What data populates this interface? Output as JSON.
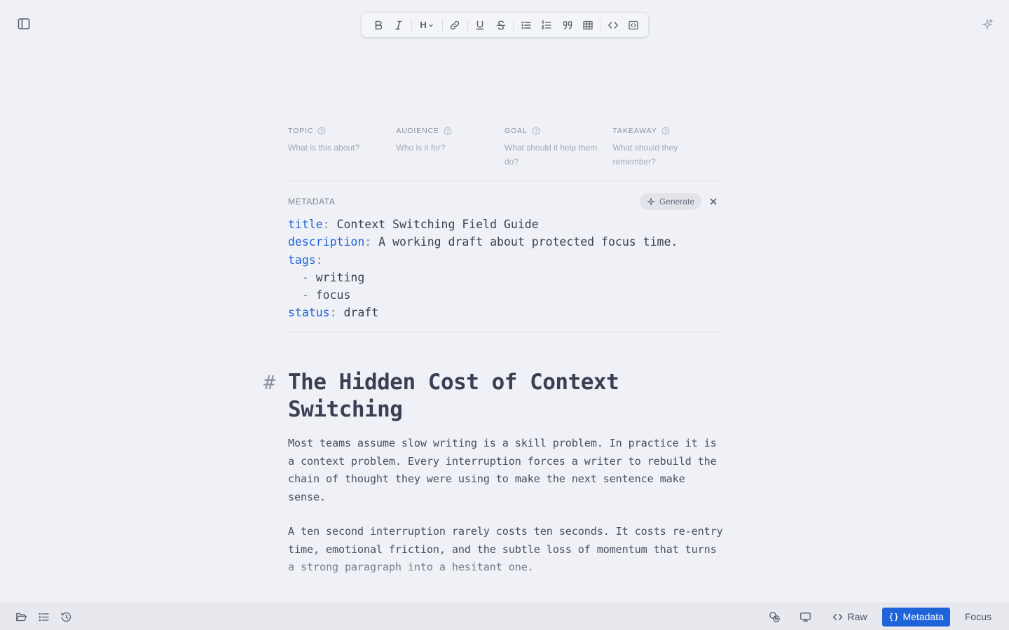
{
  "colors": {
    "accent": "#1f63d8",
    "background": "#eff1f6",
    "text": "#3d4052",
    "muted": "#8b8fa0"
  },
  "header": {
    "sidebar_toggle_icon": "sidebar-panel-icon",
    "assistant_icon": "sparkle-icon"
  },
  "toolbar": {
    "heading_label": "H",
    "icons": [
      "bold-icon",
      "italic-icon",
      "heading-icon",
      "link-icon",
      "underline-icon",
      "strikethrough-icon",
      "bullet-list-icon",
      "numbered-list-icon",
      "quote-icon",
      "table-icon",
      "code-icon",
      "code-block-icon"
    ]
  },
  "brief": {
    "topic": {
      "label": "TOPIC",
      "placeholder": "What is this about?"
    },
    "audience": {
      "label": "AUDIENCE",
      "placeholder": "Who is it for?"
    },
    "goal": {
      "label": "GOAL",
      "placeholder": "What should it help them do?"
    },
    "takeaway": {
      "label": "TAKEAWAY",
      "placeholder": "What should they remember?"
    }
  },
  "metadata": {
    "heading": "METADATA",
    "generate_label": "Generate",
    "title_key": "title",
    "title_value": "Context Switching Field Guide",
    "description_key": "description",
    "description_value": "A working draft about protected focus time.",
    "tags_key": "tags",
    "tags": [
      "writing",
      "focus"
    ],
    "status_key": "status",
    "status_value": "draft"
  },
  "document": {
    "heading_marker": "#",
    "title": "The Hidden Cost of Context Switching",
    "paragraphs": [
      "Most teams assume slow writing is a skill problem. In practice it is a context problem. Every interruption forces a writer to rebuild the chain of thought they were using to make the next sentence make sense.",
      "A ten second interruption rarely costs ten seconds. It costs re-entry time, emotional friction, and the subtle loss of momentum that turns a strong paragraph into a hesitant one."
    ]
  },
  "statusbar": {
    "left_icons": [
      "folder-open-icon",
      "outline-list-icon",
      "history-icon"
    ],
    "raw_label": "Raw",
    "metadata_label": "Metadata",
    "focus_label": "Focus"
  }
}
